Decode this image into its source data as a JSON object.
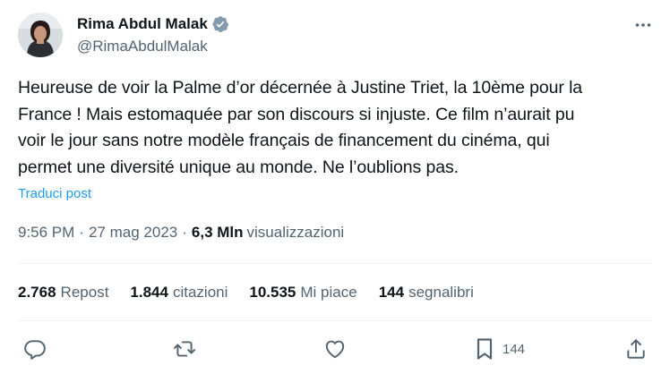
{
  "author": {
    "display_name": "Rima Abdul Malak",
    "handle": "@RimaAbdulMalak",
    "verified": true,
    "avatar_icon": "profile-photo"
  },
  "more_icon": "more-horizontal-icon",
  "tweet": {
    "text": "Heureuse de voir la Palme d’or décernée à Justine Triet, la 10ème pour la\nFrance ! Mais estomaquée par son discours si injuste. Ce film n’aurait pu\nvoir le jour sans notre modèle français de financement du cinéma, qui\npermet une diversité unique au monde. Ne l’oublions pas.",
    "translate_label": "Traduci post",
    "time": "9:56 PM",
    "date": "27 mag 2023",
    "separator": "·",
    "views_count": "6,3 Mln",
    "views_label": "visualizzazioni"
  },
  "stats": [
    {
      "value": "2.768",
      "label": "Repost"
    },
    {
      "value": "1.844",
      "label": "citazioni"
    },
    {
      "value": "10.535",
      "label": "Mi piace"
    },
    {
      "value": "144",
      "label": "segnalibri"
    }
  ],
  "actions": {
    "reply_icon": "reply-icon",
    "repost_icon": "repost-icon",
    "like_icon": "like-icon",
    "bookmark_icon": "bookmark-icon",
    "bookmark_count": "144",
    "share_icon": "share-icon"
  },
  "colors": {
    "text": "#0f1419",
    "secondary": "#536471",
    "accent": "#1d9bf0",
    "divider": "#eff3f4"
  }
}
